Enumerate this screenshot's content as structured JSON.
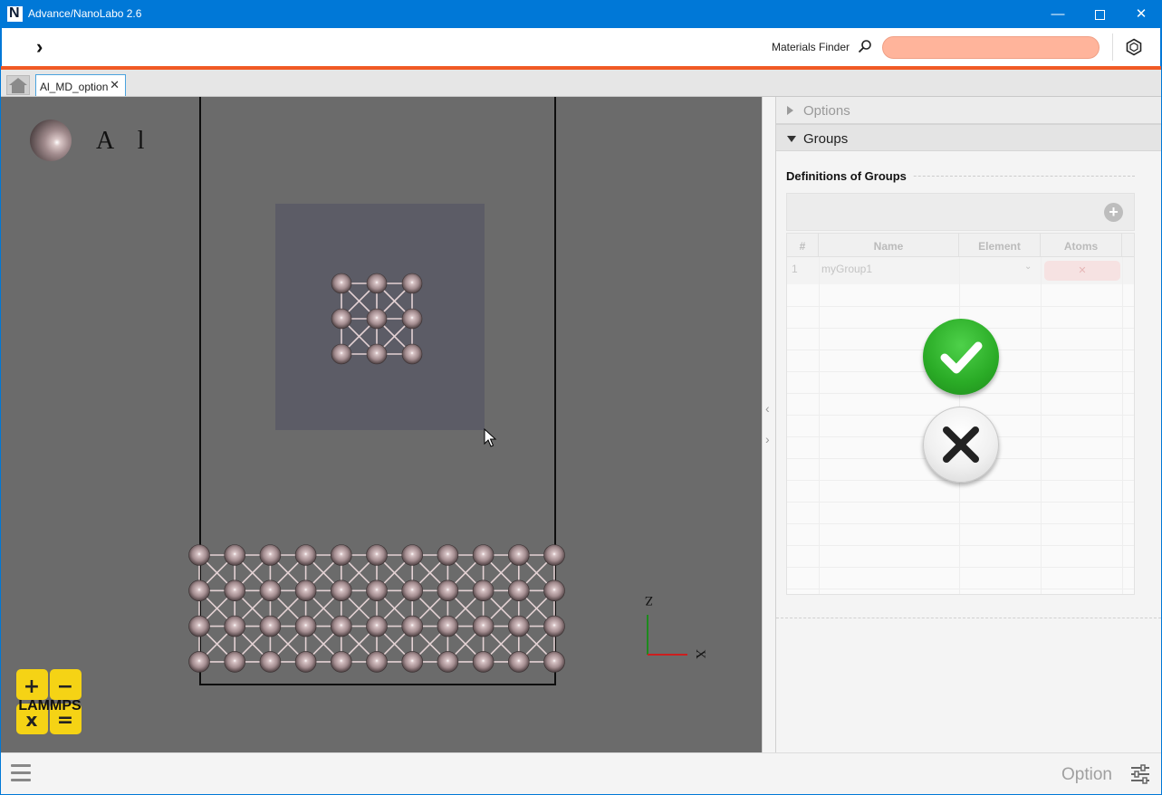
{
  "window": {
    "title": "Advance/NanoLabo 2.6",
    "minimize_glyph": "—",
    "close_glyph": "✕"
  },
  "toolbar": {
    "expand_glyph": "›",
    "materials_finder_label": "Materials Finder",
    "search_value": "",
    "icons": [
      "search-icon",
      "hexagon-icon"
    ]
  },
  "tabs": [
    {
      "label": "Al_MD_option",
      "close_glyph": "✕",
      "active": true
    }
  ],
  "viewer": {
    "legend_element": "A l",
    "axes": {
      "vertical": "Z",
      "horizontal": "X"
    },
    "logo_text": "LAMMPS",
    "logo_symbols": [
      "+",
      "−",
      "x",
      "="
    ],
    "colors": {
      "background": "#6b6b6b",
      "atom": "#b59a9e",
      "selection": "#5c5c66"
    }
  },
  "splitter": {
    "left_glyph": "‹",
    "right_glyph": "›"
  },
  "panel": {
    "options_header": "Options",
    "groups_header": "Groups",
    "groups_title": "Definitions of Groups",
    "add_glyph": "+",
    "table": {
      "columns": [
        "#",
        "Name",
        "Element",
        "Atoms"
      ],
      "rows": [
        {
          "num": "1",
          "name": "myGroup1",
          "element": "⌄",
          "atoms": "✕"
        }
      ]
    },
    "ok_glyph": "✔",
    "cancel_glyph": "✕"
  },
  "statusbar": {
    "option_label": "Option"
  },
  "colors": {
    "titlebar": "#0078d7",
    "accent_orange": "#f15a24",
    "search_fill": "#ffb49b",
    "ok_green": "#2aab26",
    "lammps_yellow": "#f5d315"
  }
}
